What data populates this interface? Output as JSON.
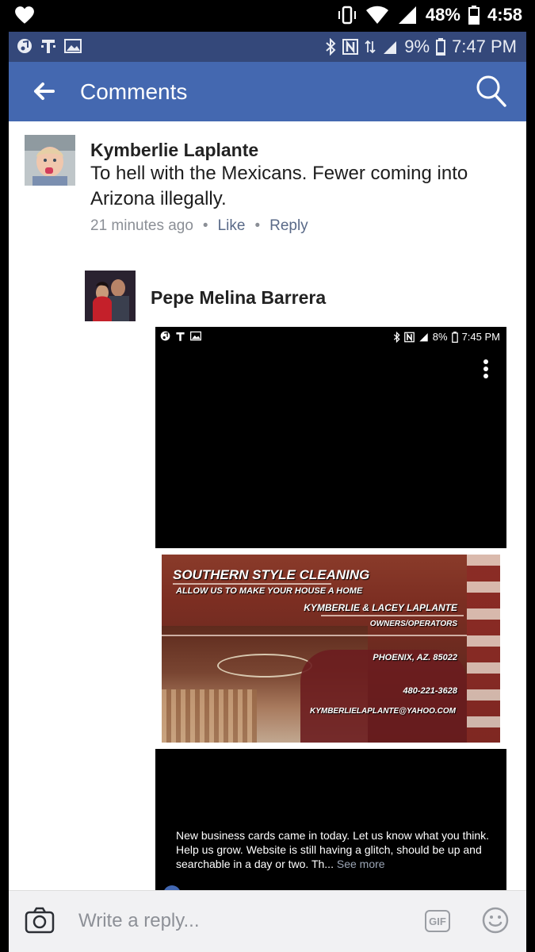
{
  "device_status": {
    "battery": "48%",
    "time": "4:58",
    "icons": [
      "heart-icon",
      "vibrate-icon",
      "wifi-icon",
      "signal-icon",
      "battery-icon"
    ]
  },
  "screenshot_status": {
    "battery": "9%",
    "time": "7:47 PM",
    "icons": [
      "music-icon",
      "t-mobile-icon",
      "image-icon",
      "bluetooth-icon",
      "nfc-icon",
      "data-icon",
      "signal-icon",
      "battery-icon"
    ]
  },
  "appbar": {
    "title": "Comments",
    "back_icon": "arrow-left-icon",
    "search_icon": "search-icon",
    "bg_color": "#4468b0"
  },
  "comments": [
    {
      "author": "Kymberlie Laplante",
      "text": "To hell with the Mexicans.  Fewer coming into Arizona illegally.",
      "time": "21 minutes ago",
      "like": "Like",
      "reply": "Reply",
      "dot": "•"
    },
    {
      "author": "Pepe Melina Barrera"
    }
  ],
  "embedded_photo": {
    "status_battery": "8%",
    "status_time": "7:45 PM",
    "business_card": {
      "company": "SOUTHERN STYLE CLEANING",
      "tagline": "ALLOW US TO MAKE YOUR HOUSE A HOME",
      "owners": "KYMBERLIE & LACEY LAPLANTE",
      "role": "OWNERS/OPERATORS",
      "city": "PHOENIX, AZ. 85022",
      "phone": "480-221-3628",
      "email": "KYMBERLIELAPLANTE@YAHOO.COM"
    },
    "caption": "New business cards came in today. Let us know what you think. Help us grow. Website is still having a glitch, should be up and searchable in a day or two. Th...",
    "see_more": "See more"
  },
  "reply_bar": {
    "placeholder": "Write a reply...",
    "gif_label": "GIF",
    "camera_icon": "camera-icon",
    "emoji_icon": "smiley-icon"
  }
}
